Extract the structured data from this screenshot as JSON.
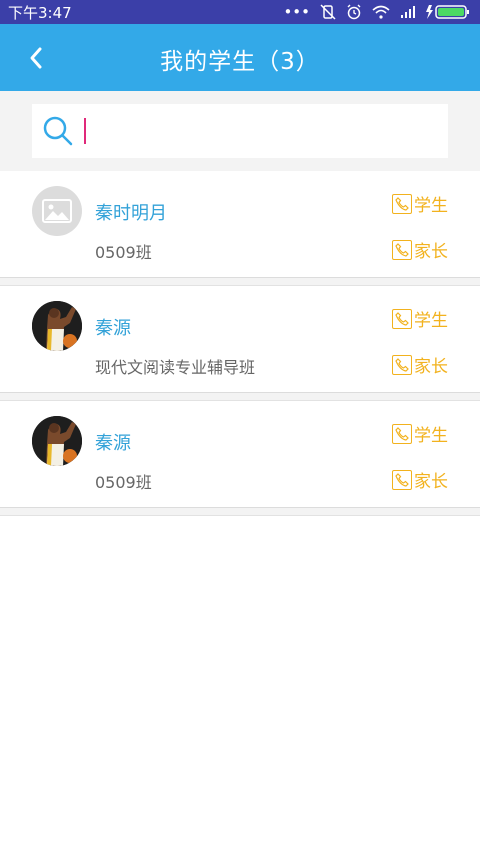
{
  "status_bar": {
    "time": "下午3:47",
    "dots": "•••"
  },
  "header": {
    "title": "我的学生（3）"
  },
  "search": {
    "placeholder": ""
  },
  "students": [
    {
      "name": "秦时明月",
      "class": "0509班",
      "avatar": "placeholder-image-icon",
      "call_student_label": "学生",
      "call_parent_label": "家长"
    },
    {
      "name": "秦源",
      "class": "现代文阅读专业辅导班",
      "avatar": "basketball-player-photo",
      "call_student_label": "学生",
      "call_parent_label": "家长"
    },
    {
      "name": "秦源",
      "class": "0509班",
      "avatar": "basketball-player-photo",
      "call_student_label": "学生",
      "call_parent_label": "家长"
    }
  ],
  "colors": {
    "header": "#33a9e8",
    "statusbar": "#3b3fa8",
    "name": "#33a2d8",
    "call": "#f2b21e",
    "caret": "#e0297a"
  }
}
